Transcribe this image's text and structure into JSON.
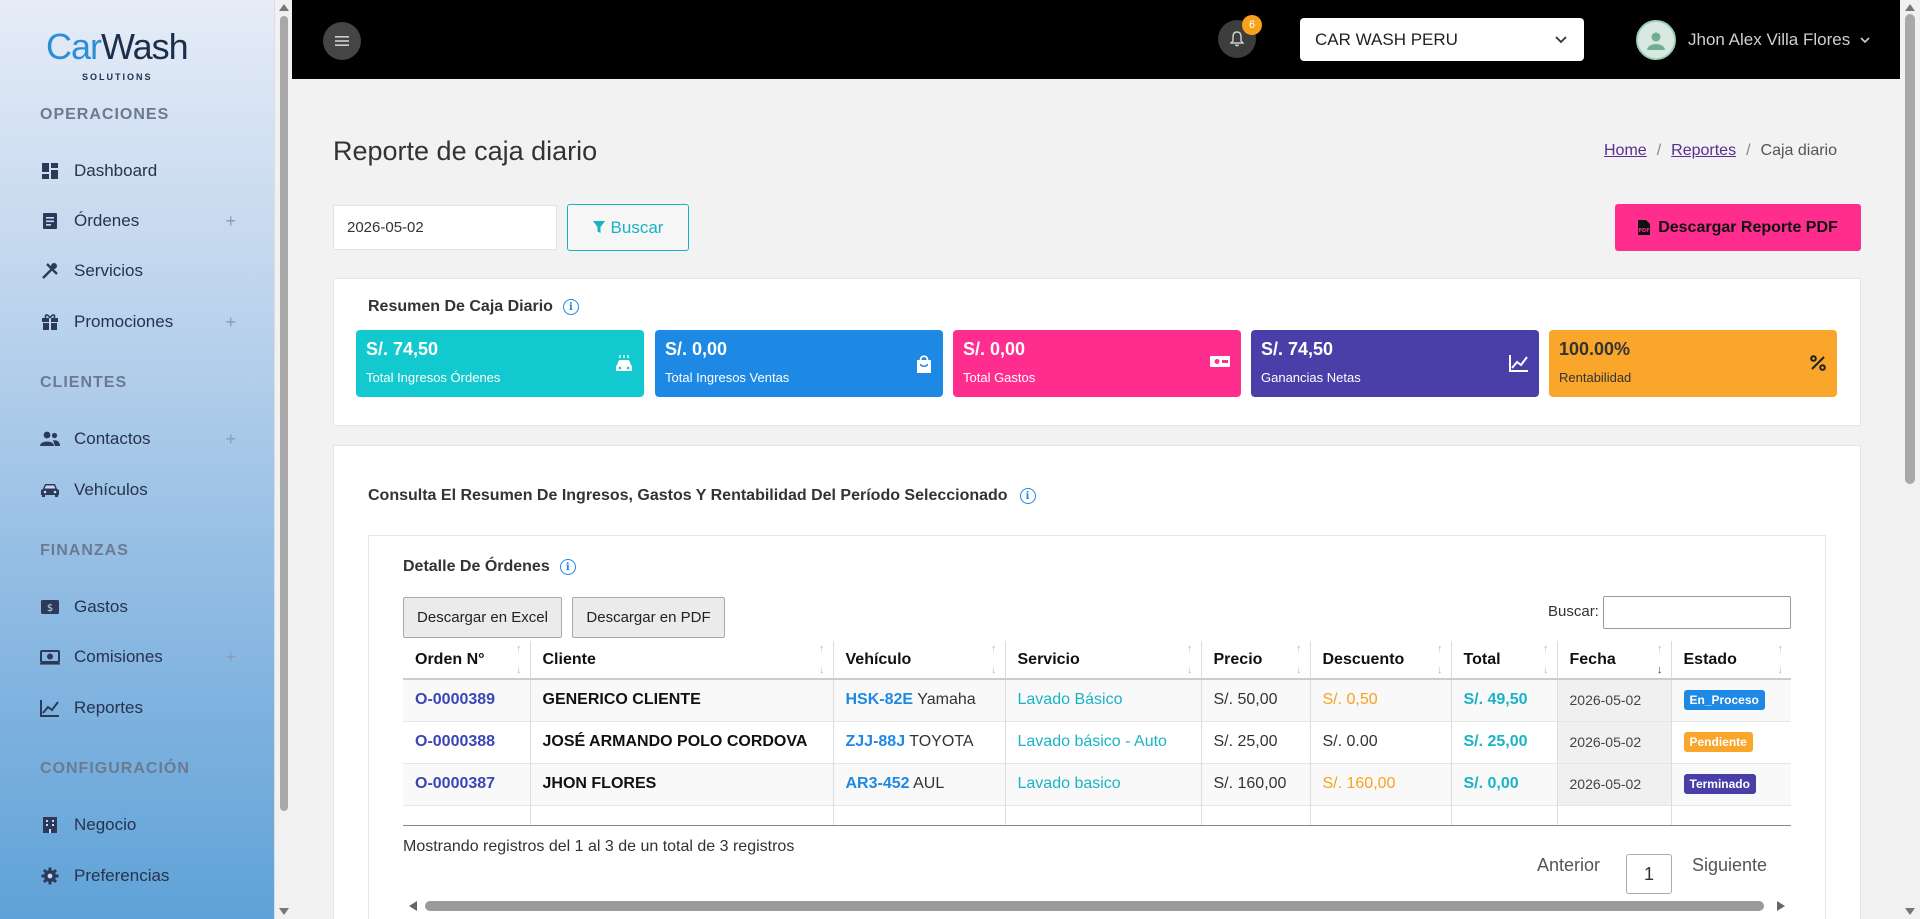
{
  "sidebar": {
    "logo": {
      "car": "Car",
      "wash": "Wash",
      "sub": "SOLUTIONS"
    },
    "sections": {
      "operaciones": "OPERACIONES",
      "clientes": "CLIENTES",
      "finanzas": "FINANZAS",
      "configuracion": "CONFIGURACIÓN"
    },
    "items": {
      "dashboard": "Dashboard",
      "ordenes": "Órdenes",
      "servicios": "Servicios",
      "promociones": "Promociones",
      "contactos": "Contactos",
      "vehiculos": "Vehículos",
      "gastos": "Gastos",
      "comisiones": "Comisiones",
      "reportes": "Reportes",
      "negocio": "Negocio",
      "preferencias": "Preferencias"
    }
  },
  "header": {
    "notifications": "6",
    "business": "CAR WASH PERU",
    "user": "Jhon Alex Villa Flores"
  },
  "page": {
    "title": "Reporte de caja diario",
    "breadcrumb": {
      "home": "Home",
      "reportes": "Reportes",
      "current": "Caja diario"
    },
    "date_value": "2026-05-02",
    "search_label": "Buscar",
    "pdf_label": "Descargar Reporte PDF"
  },
  "summary": {
    "title": "Resumen De Caja Diario",
    "cards": [
      {
        "value": "S/. 74,50",
        "label": "Total Ingresos Órdenes",
        "color": "#12c9cf"
      },
      {
        "value": "S/. 0,00",
        "label": "Total Ingresos Ventas",
        "color": "#1e88e5"
      },
      {
        "value": "S/. 0,00",
        "label": "Total Gastos",
        "color": "#ff2d8d"
      },
      {
        "value": "S/. 74,50",
        "label": "Ganancias Netas",
        "color": "#4a3fa8"
      },
      {
        "value": "100.00%",
        "label": "Rentabilidad",
        "color": "#f9a62b"
      }
    ]
  },
  "details": {
    "section_title": "Consulta El Resumen De Ingresos, Gastos Y Rentabilidad Del Período Seleccionado",
    "orders_title": "Detalle De Órdenes",
    "excel_label": "Descargar en Excel",
    "pdf_label": "Descargar en PDF",
    "search_label": "Buscar:",
    "columns": [
      "Orden N°",
      "Cliente",
      "Vehículo",
      "Servicio",
      "Precio",
      "Descuento",
      "Total",
      "Fecha",
      "Estado"
    ],
    "rows": [
      {
        "orden": "O-0000389",
        "cliente": "GENERICO CLIENTE",
        "placa": "HSK-82E",
        "marca": "Yamaha",
        "servicio": "Lavado Básico",
        "precio": "S/. 50,00",
        "descuento": "S/. 0,50",
        "total": "S/. 49,50",
        "fecha": "2026-05-02",
        "estado": "En_Proceso",
        "estado_color": "#1e88e5"
      },
      {
        "orden": "O-0000388",
        "cliente": "JOSÉ ARMANDO POLO CORDOVA",
        "placa": "ZJJ-88J",
        "marca": "TOYOTA",
        "servicio": "Lavado básico - Auto",
        "precio": "S/. 25,00",
        "descuento": "S/. 0.00",
        "total": "S/. 25,00",
        "fecha": "2026-05-02",
        "estado": "Pendiente",
        "estado_color": "#f9a62b"
      },
      {
        "orden": "O-0000387",
        "cliente": "JHON FLORES",
        "placa": "AR3-452",
        "marca": "AUL",
        "servicio": "Lavado basico",
        "precio": "S/. 160,00",
        "descuento": "S/. 160,00",
        "total": "S/. 0,00",
        "fecha": "2026-05-02",
        "estado": "Terminado",
        "estado_color": "#4a3fa8"
      }
    ],
    "showing": "Mostrando registros del 1 al 3 de un total de 3 registros",
    "prev": "Anterior",
    "page": "1",
    "next": "Siguiente"
  }
}
